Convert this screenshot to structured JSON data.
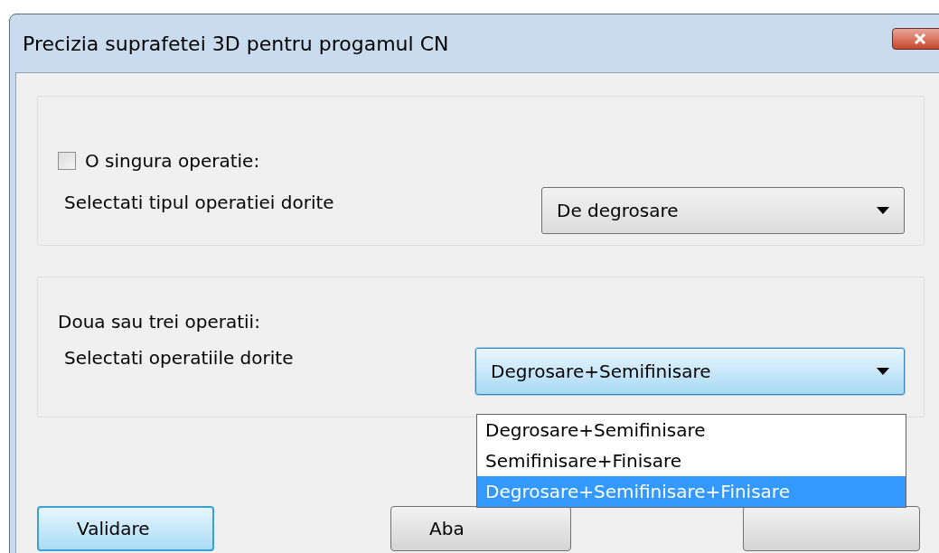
{
  "window": {
    "title": "Precizia suprafetei 3D pentru progamul CN"
  },
  "single_operation": {
    "checkbox": {
      "label": "O singura operatie:",
      "checked": false
    },
    "prompt": "Selectati tipul operatiei dorite",
    "combo": {
      "value": "De degrosare"
    }
  },
  "multi_operation": {
    "heading": "Doua sau trei operatii:",
    "prompt": "Selectati operatiile dorite",
    "combo": {
      "value": "Degrosare+Semifinisare"
    },
    "options": [
      {
        "label": "Degrosare+Semifinisare",
        "selected": false
      },
      {
        "label": "Semifinisare+Finisare",
        "selected": false
      },
      {
        "label": "Degrosare+Semifinisare+Finisare",
        "selected": true
      }
    ]
  },
  "buttons": [
    {
      "label": "Validare",
      "kind": "default"
    },
    {
      "label": "Aba",
      "kind": "normal"
    },
    {
      "kind": "normal"
    }
  ]
}
